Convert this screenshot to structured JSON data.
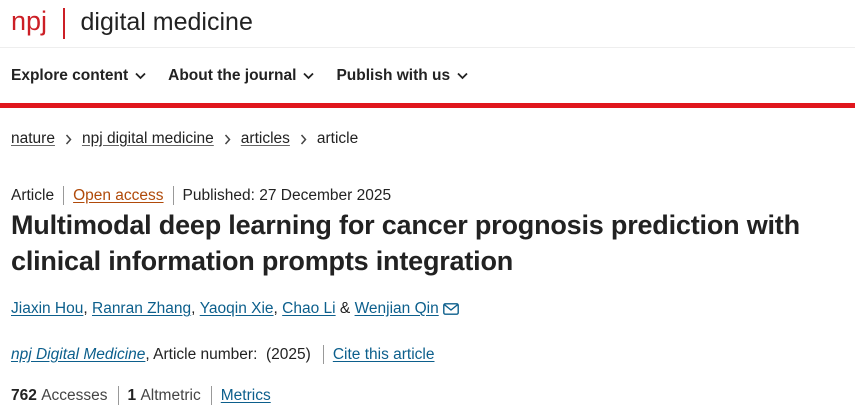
{
  "header": {
    "brand_short": "npj",
    "brand_title": "digital medicine"
  },
  "nav": {
    "items": [
      {
        "label": "Explore content"
      },
      {
        "label": "About the journal"
      },
      {
        "label": "Publish with us"
      }
    ]
  },
  "breadcrumb": {
    "items": [
      "nature",
      "npj digital medicine",
      "articles"
    ],
    "current": "article"
  },
  "article": {
    "type": "Article",
    "access": "Open access",
    "published": "Published: 27 December 2025",
    "title": "Multimodal deep learning for cancer prognosis prediction with clinical information prompts integration",
    "authors": [
      "Jiaxin Hou",
      "Ranran Zhang",
      "Yaoqin Xie",
      "Chao Li",
      "Wenjian Qin"
    ],
    "author_sep": ", ",
    "author_last_sep": " & ",
    "journal": "npj Digital Medicine",
    "article_number_label": ", Article number:  (2025)",
    "cite_label": "Cite this article"
  },
  "metrics": {
    "accesses_count": "762",
    "accesses_label": "Accesses",
    "altmetric_count": "1",
    "altmetric_label": "Altmetric",
    "metrics_link": "Metrics"
  },
  "colors": {
    "brand_red": "#cc1f26",
    "link_blue": "#0c5f8c",
    "open_access_orange": "#b04a0a"
  }
}
